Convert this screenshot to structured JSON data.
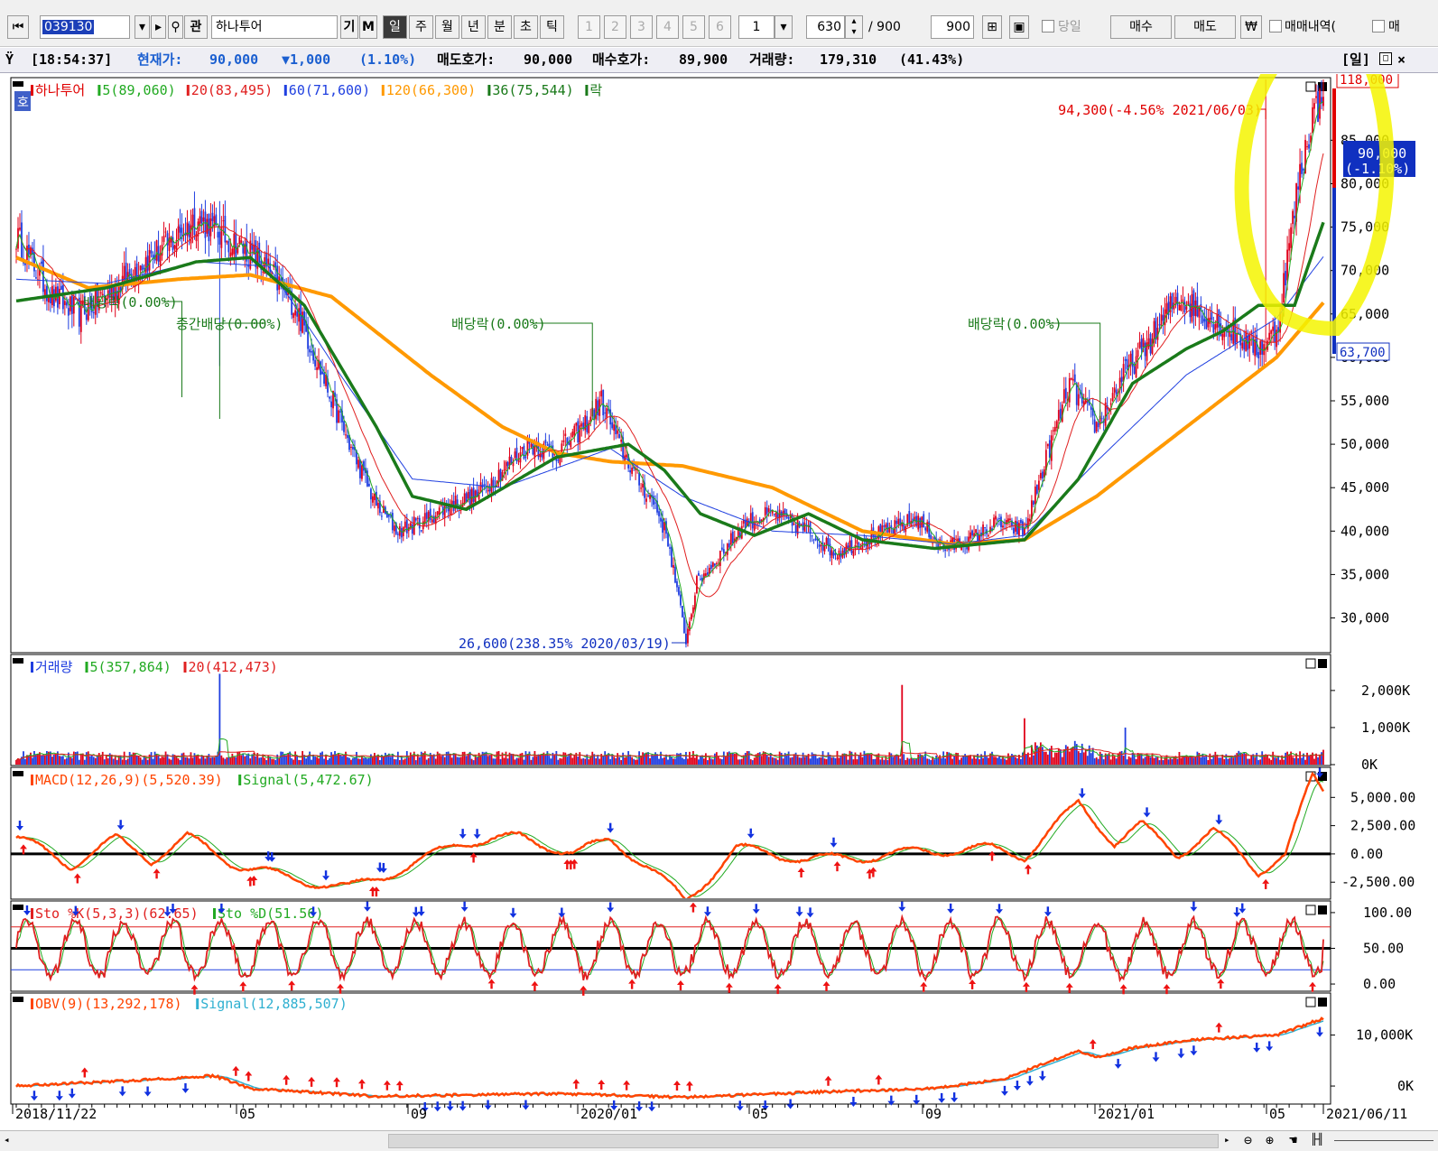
{
  "toolbar": {
    "code": "039130",
    "name": "하나투어",
    "btn_gi": "기",
    "btn_m": "M",
    "periods": [
      "일",
      "주",
      "월",
      "년",
      "분",
      "초",
      "틱"
    ],
    "period_selected": "일",
    "numbers": [
      "1",
      "2",
      "3",
      "4",
      "5",
      "6"
    ],
    "num_select": "1",
    "count": "630",
    "total_sep": "/ 900",
    "total": "900",
    "today": "당일",
    "buy": "매수",
    "sell": "매도",
    "won": "₩",
    "trade_history": "매매내역(",
    "trade_tail": "매"
  },
  "infobar": {
    "time": "[18:54:37]",
    "price_label": "현재가:",
    "price": "90,000",
    "change": "▼1,000",
    "change_pct": "(1.10%)",
    "ask_label": "매도호가:",
    "ask": "90,000",
    "bid_label": "매수호가:",
    "bid": "89,900",
    "volume_label": "거래량:",
    "volume": "179,310",
    "volume_pct": "(41.43%)",
    "period_tag": "[일]"
  },
  "colors": {
    "candle_up": "#e0001a",
    "candle_down": "#1f3ee0",
    "ma5": "#22aa22",
    "ma20": "#e02020",
    "ma60": "#2040e0",
    "ma120": "#ff9900",
    "ma36": "#1a7a1a",
    "highlight": "#ffff00"
  },
  "chart_data": [
    {
      "type": "candlestick",
      "name": "price",
      "legend": [
        {
          "label": "하나투어",
          "color": "#e00000"
        },
        {
          "label": "5(89,060)",
          "color": "#22aa22"
        },
        {
          "label": "20(83,495)",
          "color": "#e02020"
        },
        {
          "label": "60(71,600)",
          "color": "#2040e0"
        },
        {
          "label": "120(66,300)",
          "color": "#ff9900"
        },
        {
          "label": "36(75,544)",
          "color": "#1a7a1a"
        },
        {
          "label": "락",
          "color": "#1a7a1a"
        }
      ],
      "y_ticks": [
        "85,000",
        "80,000",
        "75,000",
        "70,000",
        "65,000",
        "60,000",
        "55,000",
        "50,000",
        "45,000",
        "40,000",
        "35,000",
        "30,000"
      ],
      "ylim": [
        26000,
        92000
      ],
      "max_label": "118,000",
      "min_label": "63,700",
      "current_label": "90,000",
      "current_pct": "(-1.10%)",
      "annotations": [
        {
          "text": "94,300(-4.56% 2021/06/03)",
          "color": "#e00000"
        },
        {
          "text": "26,600(238.35% 2020/03/19)",
          "color": "#1030c0"
        },
        {
          "text": "배당락(0.00%)",
          "color": "#1a7a1a"
        },
        {
          "text": "중간배당(0.00%)",
          "color": "#1a7a1a"
        },
        {
          "text": "배당락(0.00%)",
          "color": "#1a7a1a"
        },
        {
          "text": "배당락(0.00%)",
          "color": "#1a7a1a"
        }
      ],
      "x_labels": [
        "2018/11/22",
        "05",
        "09",
        "2020/01",
        "05",
        "09",
        "2021/01",
        "05",
        "2021/06/11"
      ],
      "close_path_keypoints": [
        [
          0,
          74000
        ],
        [
          20,
          67000
        ],
        [
          35,
          65000
        ],
        [
          55,
          68000
        ],
        [
          70,
          71000
        ],
        [
          85,
          73000
        ],
        [
          100,
          76000
        ],
        [
          115,
          74000
        ],
        [
          130,
          72000
        ],
        [
          140,
          70000
        ],
        [
          155,
          66000
        ],
        [
          170,
          58000
        ],
        [
          185,
          50000
        ],
        [
          200,
          43000
        ],
        [
          212,
          40000
        ],
        [
          225,
          41000
        ],
        [
          240,
          43000
        ],
        [
          255,
          44000
        ],
        [
          270,
          47000
        ],
        [
          285,
          50000
        ],
        [
          300,
          49000
        ],
        [
          315,
          52000
        ],
        [
          325,
          55000
        ],
        [
          335,
          50000
        ],
        [
          345,
          46000
        ],
        [
          355,
          43000
        ],
        [
          362,
          39000
        ],
        [
          368,
          32000
        ],
        [
          372,
          27500
        ],
        [
          378,
          34000
        ],
        [
          390,
          37000
        ],
        [
          405,
          41000
        ],
        [
          420,
          42000
        ],
        [
          440,
          40000
        ],
        [
          455,
          37500
        ],
        [
          470,
          39000
        ],
        [
          485,
          40000
        ],
        [
          500,
          41500
        ],
        [
          515,
          38000
        ],
        [
          530,
          39000
        ],
        [
          545,
          41000
        ],
        [
          560,
          40000
        ],
        [
          570,
          47000
        ],
        [
          585,
          57000
        ],
        [
          600,
          52000
        ],
        [
          615,
          58000
        ],
        [
          630,
          62000
        ],
        [
          645,
          67000
        ],
        [
          660,
          65000
        ],
        [
          675,
          63000
        ],
        [
          690,
          61000
        ],
        [
          700,
          63000
        ],
        [
          705,
          70000
        ],
        [
          712,
          80000
        ],
        [
          720,
          88000
        ],
        [
          726,
          90000
        ]
      ],
      "ma120_keypoints": [
        [
          0,
          71500
        ],
        [
          40,
          68000
        ],
        [
          90,
          69000
        ],
        [
          130,
          69500
        ],
        [
          175,
          67000
        ],
        [
          230,
          58000
        ],
        [
          270,
          52000
        ],
        [
          300,
          49000
        ],
        [
          330,
          48000
        ],
        [
          370,
          47500
        ],
        [
          420,
          45000
        ],
        [
          470,
          40000
        ],
        [
          520,
          38500
        ],
        [
          560,
          39000
        ],
        [
          600,
          44000
        ],
        [
          650,
          52000
        ],
        [
          700,
          60000
        ],
        [
          726,
          66300
        ]
      ],
      "ma60_keypoints": [
        [
          0,
          69000
        ],
        [
          50,
          68500
        ],
        [
          100,
          71000
        ],
        [
          140,
          70500
        ],
        [
          180,
          58000
        ],
        [
          220,
          46000
        ],
        [
          270,
          45000
        ],
        [
          330,
          49500
        ],
        [
          370,
          44000
        ],
        [
          420,
          40000
        ],
        [
          470,
          39500
        ],
        [
          520,
          38500
        ],
        [
          560,
          39500
        ],
        [
          600,
          48000
        ],
        [
          650,
          58000
        ],
        [
          700,
          64500
        ],
        [
          726,
          71600
        ]
      ],
      "ma36_keypoints": [
        [
          0,
          66500
        ],
        [
          50,
          68000
        ],
        [
          100,
          71000
        ],
        [
          130,
          71500
        ],
        [
          160,
          66000
        ],
        [
          200,
          52000
        ],
        [
          220,
          44000
        ],
        [
          250,
          42500
        ],
        [
          300,
          48500
        ],
        [
          340,
          50000
        ],
        [
          360,
          47000
        ],
        [
          380,
          42000
        ],
        [
          410,
          39500
        ],
        [
          440,
          42000
        ],
        [
          470,
          39000
        ],
        [
          510,
          38000
        ],
        [
          560,
          39000
        ],
        [
          590,
          46000
        ],
        [
          620,
          57000
        ],
        [
          650,
          61000
        ],
        [
          670,
          63000
        ],
        [
          690,
          66000
        ],
        [
          710,
          66000
        ],
        [
          726,
          75544
        ]
      ]
    },
    {
      "type": "bar",
      "name": "volume",
      "legend": [
        {
          "label": "거래량",
          "color": "#1f3ee0"
        },
        {
          "label": "5(357,864)",
          "color": "#22aa22"
        },
        {
          "label": "20(412,473)",
          "color": "#e02020"
        }
      ],
      "y_ticks": [
        "2,000K",
        "1,000K",
        "0K"
      ],
      "ylim": [
        0,
        2800000
      ],
      "spikes": [
        [
          113,
          2450000
        ],
        [
          492,
          2150000
        ],
        [
          560,
          1250000
        ],
        [
          616,
          1000000
        ],
        [
          726,
          400000
        ]
      ]
    },
    {
      "type": "line",
      "name": "MACD",
      "legend": [
        {
          "label": "MACD(12,26,9)(5,520.39)",
          "color": "#ff4400"
        },
        {
          "label": "Signal(5,472.67)",
          "color": "#22aa22"
        }
      ],
      "y_ticks": [
        "5,000.00",
        "2,500.00",
        "0.00",
        "-2,500.00"
      ],
      "ylim": [
        -4000,
        7500
      ],
      "keypoints": [
        [
          0,
          1500
        ],
        [
          30,
          -1000
        ],
        [
          55,
          1300
        ],
        [
          75,
          -500
        ],
        [
          95,
          1500
        ],
        [
          120,
          -800
        ],
        [
          150,
          -2100
        ],
        [
          185,
          -3000
        ],
        [
          220,
          -1000
        ],
        [
          245,
          1000
        ],
        [
          280,
          1500
        ],
        [
          310,
          0
        ],
        [
          330,
          1300
        ],
        [
          350,
          -1000
        ],
        [
          372,
          -4200
        ],
        [
          400,
          500
        ],
        [
          440,
          -500
        ],
        [
          470,
          -300
        ],
        [
          500,
          200
        ],
        [
          540,
          500
        ],
        [
          560,
          -200
        ],
        [
          590,
          4500
        ],
        [
          610,
          1000
        ],
        [
          625,
          2500
        ],
        [
          645,
          0
        ],
        [
          665,
          2000
        ],
        [
          690,
          -1500
        ],
        [
          705,
          0
        ],
        [
          720,
          6800
        ],
        [
          726,
          5520
        ]
      ]
    },
    {
      "type": "line",
      "name": "stochastic",
      "legend": [
        {
          "label": "Sto %K(5,3,3)(62.65)",
          "color": "#e02020"
        },
        {
          "label": "Sto %D(51.56)",
          "color": "#22aa22"
        }
      ],
      "y_ticks": [
        "100.00",
        "50.00",
        "0.00"
      ],
      "ylim": [
        -5,
        110
      ]
    },
    {
      "type": "line",
      "name": "OBV",
      "legend": [
        {
          "label": "OBV(9)(13,292,178)",
          "color": "#ff4400"
        },
        {
          "label": "Signal(12,885,507)",
          "color": "#30b0d0"
        }
      ],
      "y_ticks": [
        "10,000K",
        "0K"
      ],
      "ylim": [
        -3000000,
        17000000
      ],
      "keypoints": [
        [
          0,
          0
        ],
        [
          60,
          1000000
        ],
        [
          110,
          2000000
        ],
        [
          130,
          -500000
        ],
        [
          200,
          -2000000
        ],
        [
          300,
          -1500000
        ],
        [
          370,
          -2200000
        ],
        [
          460,
          -1000000
        ],
        [
          510,
          -500000
        ],
        [
          550,
          1500000
        ],
        [
          590,
          7000000
        ],
        [
          600,
          5500000
        ],
        [
          620,
          7500000
        ],
        [
          650,
          9000000
        ],
        [
          700,
          10000000
        ],
        [
          726,
          13300000
        ]
      ]
    }
  ]
}
